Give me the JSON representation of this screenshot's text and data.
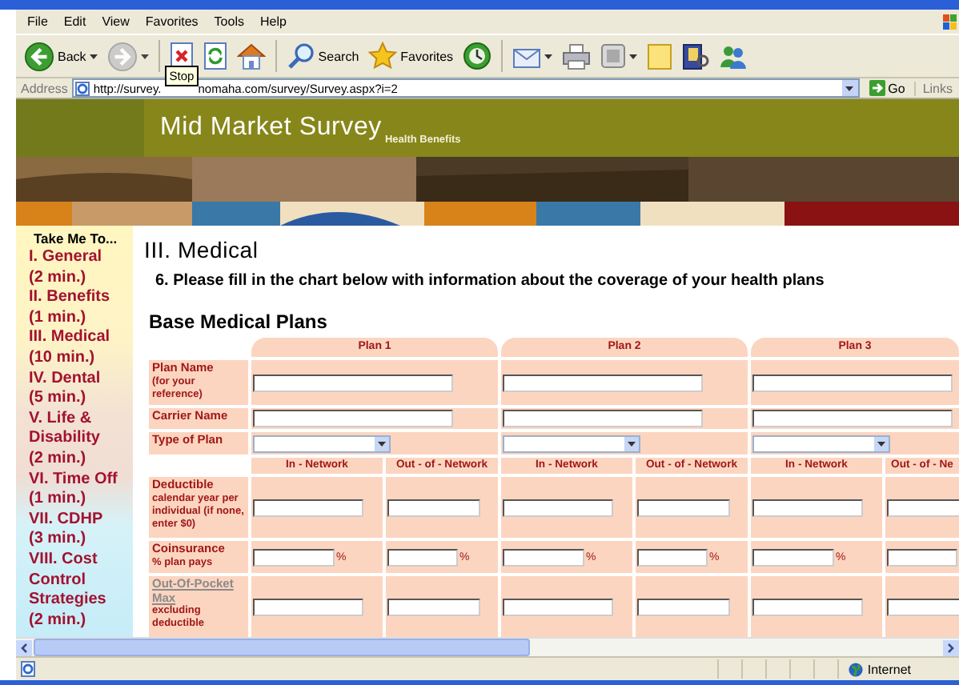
{
  "menu": [
    "File",
    "Edit",
    "View",
    "Favorites",
    "Tools",
    "Help"
  ],
  "toolbar": [
    {
      "kind": "back",
      "label": "Back",
      "dropdown": true,
      "disabled": false
    },
    {
      "kind": "forward",
      "dropdown": true,
      "disabled": true
    },
    {
      "kind": "stop",
      "dropdown": false,
      "disabled": false
    },
    {
      "kind": "refresh",
      "dropdown": false,
      "disabled": false
    },
    {
      "kind": "home",
      "dropdown": false,
      "disabled": false
    },
    {
      "kind": "search",
      "label": "Search",
      "dropdown": false,
      "disabled": false
    },
    {
      "kind": "favorites",
      "label": "Favorites",
      "dropdown": false,
      "disabled": false
    },
    {
      "kind": "history",
      "dropdown": false,
      "disabled": false
    },
    {
      "kind": "mail",
      "dropdown": true,
      "disabled": false
    },
    {
      "kind": "print",
      "dropdown": false,
      "disabled": false
    },
    {
      "kind": "edit",
      "dropdown": true,
      "disabled": false
    },
    {
      "kind": "notes",
      "dropdown": false,
      "disabled": false
    },
    {
      "kind": "research",
      "dropdown": false,
      "disabled": false
    },
    {
      "kind": "messenger",
      "dropdown": false,
      "disabled": false
    }
  ],
  "tooltip": "Stop",
  "address": {
    "label": "Address",
    "url_parts": [
      "http://survey.",
      "nomaha.com/survey/Survey.aspx?i=2"
    ],
    "go": "Go",
    "links": "Links"
  },
  "banner": {
    "title": "Mid Market Survey",
    "subtitle": "Health Benefits"
  },
  "sidebar": {
    "heading": "Take Me To...",
    "items": [
      {
        "title": "I. General",
        "time": "(2 min.)"
      },
      {
        "title": "II. Benefits",
        "time": "(1 min.)"
      },
      {
        "title": "III. Medical",
        "time": "(10 min.)"
      },
      {
        "title": "IV. Dental",
        "time": "(5 min.)"
      },
      {
        "title": "V. Life & Disability",
        "time": "(2 min.)"
      },
      {
        "title": "VI. Time Off",
        "time": "(1 min.)"
      },
      {
        "title": "VII. CDHP",
        "time": "(3 min.)"
      },
      {
        "title": "VIII. Cost Control Strategies",
        "time": "(2 min.)"
      }
    ]
  },
  "main": {
    "section_title": "III. Medical",
    "question": "6. Please fill in the chart below with information about the coverage of your health plans",
    "table_title": "Base Medical Plans"
  },
  "table": {
    "plans": [
      "Plan 1",
      "Plan 2",
      "Plan 3"
    ],
    "plan_rows": [
      {
        "kind": "text",
        "label": "Plan Name",
        "note": "(for your reference)"
      },
      {
        "kind": "text",
        "label": "Carrier Name"
      },
      {
        "kind": "select",
        "label": "Type of Plan"
      }
    ],
    "network_headers": [
      "In - Network",
      "Out - of - Network",
      "In - Network",
      "Out - of - Network",
      "In - Network",
      "Out - of - Ne"
    ],
    "network_rows": [
      {
        "kind": "text",
        "label": "Deductible",
        "note": "calendar year per individual (if none, enter $0)",
        "link": false
      },
      {
        "kind": "percent",
        "label": "Coinsurance",
        "note": "% plan pays",
        "link": false,
        "units": [
          "%",
          "%",
          "%",
          "%",
          "%"
        ]
      },
      {
        "kind": "text",
        "label": "Out-Of-Pocket Max",
        "note": "excluding deductible",
        "link": true
      }
    ]
  },
  "status_bar": {
    "zone": "Internet"
  }
}
